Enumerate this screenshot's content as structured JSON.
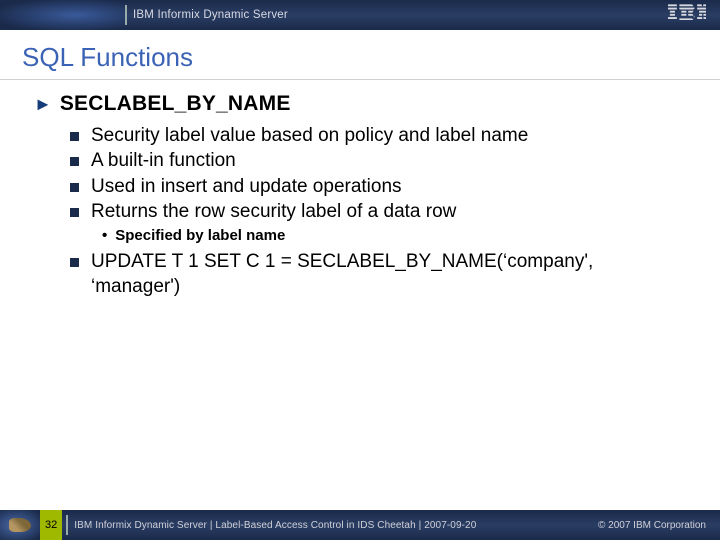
{
  "header": {
    "product": "IBM Informix Dynamic Server",
    "logo_label": "IBM"
  },
  "slide": {
    "title": "SQL Functions",
    "section": {
      "heading": "SECLABEL_BY_NAME",
      "bullets": [
        "Security label value based on policy and label name",
        "A built-in function",
        "Used in insert and update operations",
        "Returns the row security label of a data row"
      ],
      "sub_bullets": [
        "Specified by label name"
      ],
      "example": "UPDATE T 1 SET C 1 = SECLABEL_BY_NAME(‘company', ‘manager')"
    }
  },
  "footer": {
    "page_number": "32",
    "text": "IBM Informix Dynamic Server  |  Label-Based Access Control in IDS Cheetah | 2007-09-20",
    "copyright": "© 2007 IBM Corporation"
  }
}
